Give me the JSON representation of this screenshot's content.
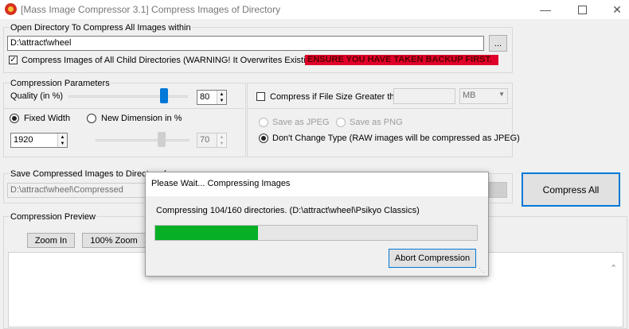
{
  "window": {
    "title": "[Mass Image Compressor 3.1] Compress Images of Directory"
  },
  "open_dir": {
    "group_label": "Open Directory To Compress All Images within",
    "path_value": "D:\\attract\\wheel",
    "browse_label": "...",
    "child_dirs_label": "Compress Images of All Child Directories (WARNING! It Overwrites Existing Images)",
    "warning_text": "ENSURE YOU HAVE TAKEN BACKUP FIRST."
  },
  "compression": {
    "group_label": "Compression Parameters",
    "quality_label": "Quality (in %)",
    "quality_value": "80",
    "quality_fraction": 0.8,
    "fixed_width_label": "Fixed Width",
    "new_dimension_label": "New Dimension in %",
    "width_value": "1920",
    "dimension_value": "70",
    "dimension_fraction": 0.7
  },
  "size_filter": {
    "label": "Compress if File Size Greater than",
    "value": "",
    "unit": "MB"
  },
  "output_type": {
    "jpeg_label": "Save as JPEG",
    "png_label": "Save as PNG",
    "no_change_label": "Don't Change Type (RAW images will be compressed as JPEG)"
  },
  "save_dir": {
    "group_label": "Save Compressed Images to Directory (",
    "path_value": "D:\\attract\\wheel\\Compressed"
  },
  "compress_all_label": "Compress All",
  "preview": {
    "group_label": "Compression Preview",
    "zoom_in_label": "Zoom In",
    "zoom_100_label": "100% Zoom"
  },
  "dialog": {
    "title": "Please Wait... Compressing Images",
    "status": "Compressing 104/160 directories. (D:\\attract\\wheel\\Psikyo Classics)",
    "progress_fraction": 0.32,
    "abort_label": "Abort Compression"
  },
  "colors": {
    "warning_bg": "#e0002a",
    "progress_fill": "#06b025",
    "slider_thumb": "#0078d7",
    "focus_border": "#0078d7"
  }
}
